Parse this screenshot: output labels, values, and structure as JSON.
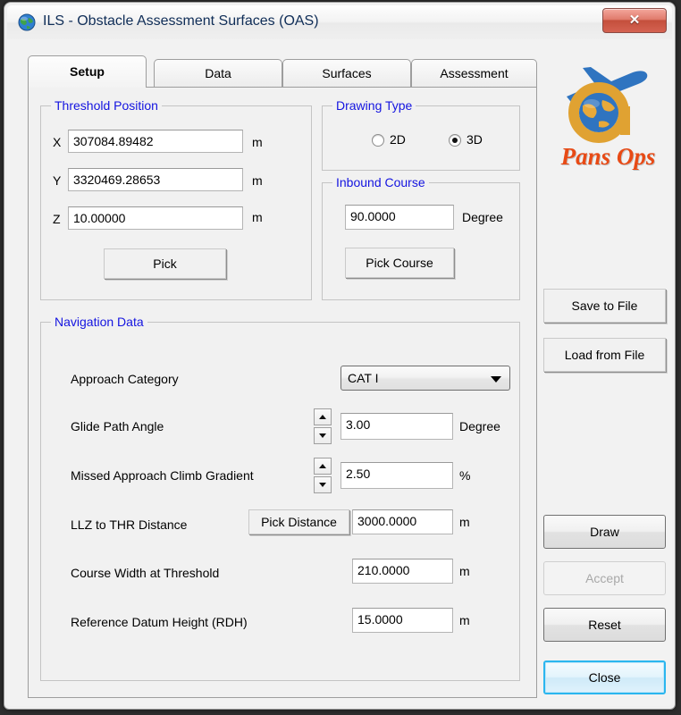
{
  "window": {
    "title": "ILS - Obstacle Assessment Surfaces (OAS)",
    "icon": "globe-icon",
    "close_glyph": "✕",
    "accent_blue": "#1414e0",
    "title_color": "#0f2d57",
    "default_button_border": "#2bb6ef"
  },
  "tabs": [
    {
      "label": "Setup",
      "active": true
    },
    {
      "label": "Data",
      "active": false
    },
    {
      "label": "Surfaces",
      "active": false
    },
    {
      "label": "Assessment",
      "active": false
    }
  ],
  "threshold_position": {
    "title": "Threshold Position",
    "fields": [
      {
        "label": "X",
        "value": "307084.89482",
        "unit": "m"
      },
      {
        "label": "Y",
        "value": "3320469.28653",
        "unit": "m"
      },
      {
        "label": "Z",
        "value": "10.00000",
        "unit": "m"
      }
    ],
    "pick_button": "Pick"
  },
  "drawing_type": {
    "title": "Drawing Type",
    "options": [
      {
        "label": "2D",
        "selected": false
      },
      {
        "label": "3D",
        "selected": true
      }
    ]
  },
  "inbound_course": {
    "title": "Inbound Course",
    "value": "90.0000",
    "unit": "Degree",
    "pick_button": "Pick Course"
  },
  "navigation_data": {
    "title": "Navigation Data",
    "approach_category": {
      "label": "Approach Category",
      "value": "CAT I"
    },
    "glide_path_angle": {
      "label": "Glide Path Angle",
      "value": "3.00",
      "unit": "Degree"
    },
    "missed_approach_climb_gradient": {
      "label": "Missed Approach Climb Gradient",
      "value": "2.50",
      "unit": "%"
    },
    "llz_to_thr_distance": {
      "label": "LLZ to THR Distance",
      "pick_button": "Pick Distance",
      "value": "3000.0000",
      "unit": "m"
    },
    "course_width_at_threshold": {
      "label": "Course Width at Threshold",
      "value": "210.0000",
      "unit": "m"
    },
    "reference_datum_height": {
      "label": "Reference Datum Height (RDH)",
      "value": "15.0000",
      "unit": "m"
    }
  },
  "side_buttons": {
    "save_to_file": "Save to File",
    "load_from_file": "Load from File",
    "draw": "Draw",
    "accept": "Accept",
    "reset": "Reset",
    "close": "Close"
  },
  "logo": {
    "brand": "Pans Ops"
  }
}
